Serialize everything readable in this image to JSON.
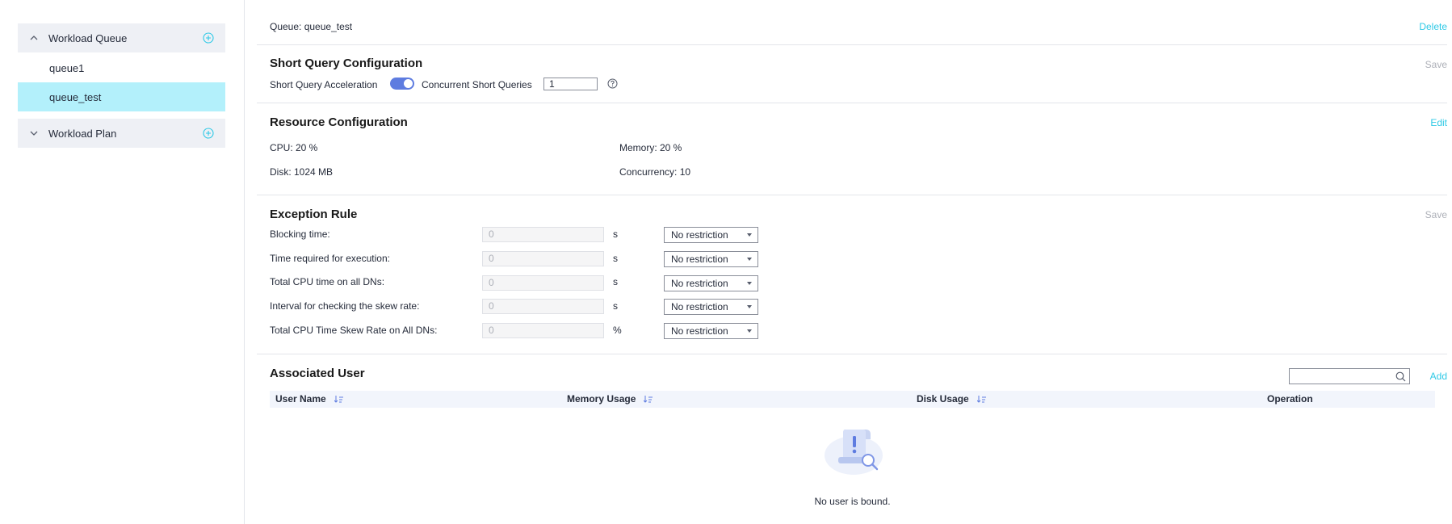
{
  "sidebar": {
    "groups": [
      {
        "label": "Workload Queue",
        "expanded": true,
        "items": [
          "queue1",
          "queue_test"
        ],
        "active_item": "queue_test"
      },
      {
        "label": "Workload Plan",
        "expanded": false
      }
    ]
  },
  "queue": {
    "title": "Queue: queue_test",
    "delete_label": "Delete"
  },
  "short_query": {
    "title": "Short Query Configuration",
    "save_label": "Save",
    "acceleration_label": "Short Query Acceleration",
    "acceleration_on": true,
    "concurrent_label": "Concurrent Short Queries",
    "concurrent_value": "1"
  },
  "resource": {
    "title": "Resource Configuration",
    "edit_label": "Edit",
    "cpu": "CPU: 20 %",
    "memory": "Memory: 20 %",
    "disk": "Disk: 1024 MB",
    "concurrency": "Concurrency: 10"
  },
  "exception": {
    "title": "Exception Rule",
    "save_label": "Save",
    "rules": [
      {
        "label": "Blocking time:",
        "value": "0",
        "unit": "s",
        "action": "No restriction"
      },
      {
        "label": "Time required for execution:",
        "value": "0",
        "unit": "s",
        "action": "No restriction"
      },
      {
        "label": "Total CPU time on all DNs:",
        "value": "0",
        "unit": "s",
        "action": "No restriction"
      },
      {
        "label": "Interval for checking the skew rate:",
        "value": "0",
        "unit": "s",
        "action": "No restriction"
      },
      {
        "label": "Total CPU Time Skew Rate on All DNs:",
        "value": "0",
        "unit": "%",
        "action": "No restriction"
      }
    ]
  },
  "users": {
    "title": "Associated User",
    "add_label": "Add",
    "search_placeholder": "",
    "columns": [
      "User Name",
      "Memory Usage",
      "Disk Usage",
      "Operation"
    ],
    "empty_text": "No user is bound."
  },
  "colors": {
    "accent": "#2ec9e6",
    "toggle": "#5e7ce0",
    "active_item": "#b3f0fb"
  }
}
